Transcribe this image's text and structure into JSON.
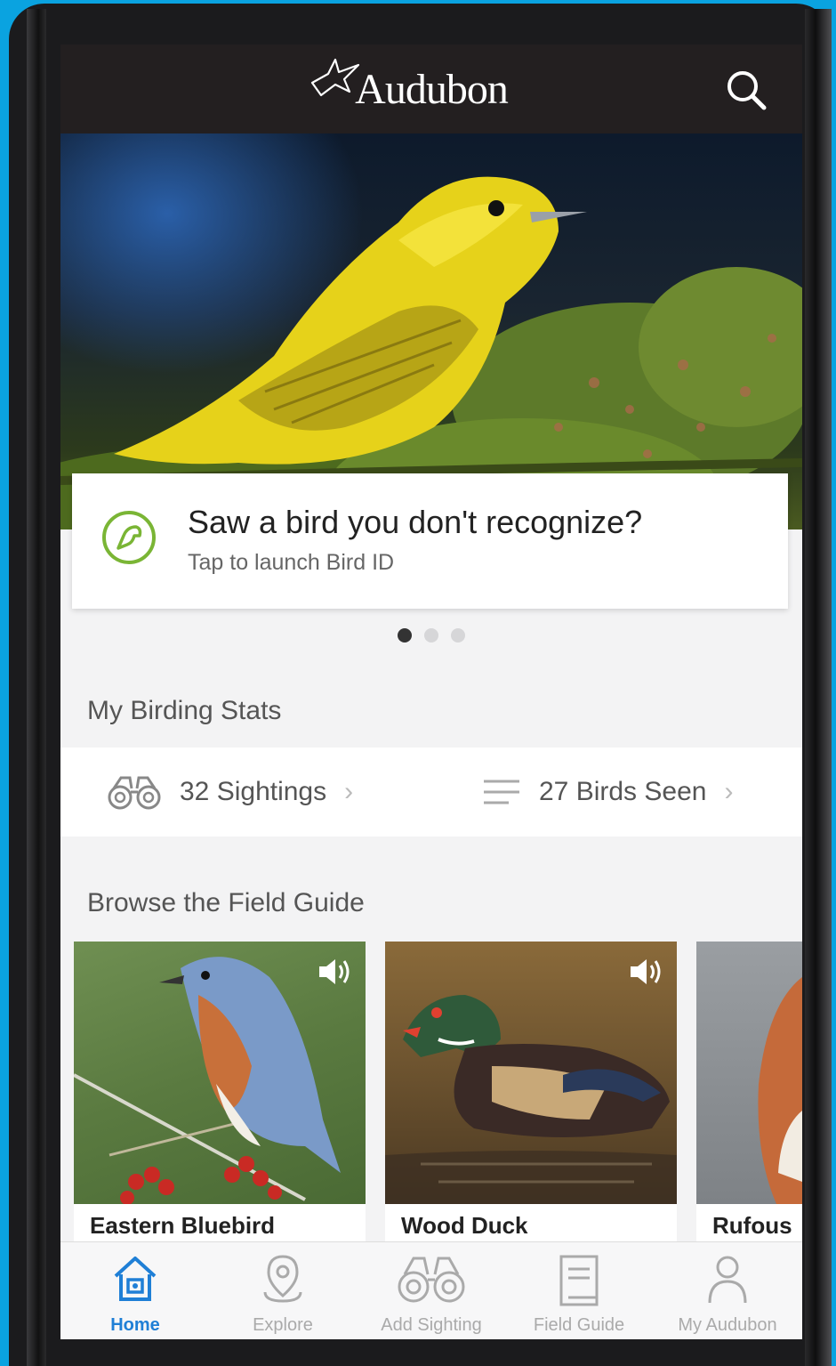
{
  "header": {
    "logo_text": "Audubon",
    "search_icon": "search-icon"
  },
  "hero": {
    "image_alt": "Yellow warbler perched on juniper"
  },
  "bird_id_card": {
    "title": "Saw a bird you don't recognize?",
    "subtitle": "Tap to launch Bird ID",
    "icon": "bird-id-icon",
    "accent_color": "#7ab535"
  },
  "carousel": {
    "page_count": 3,
    "active_index": 0
  },
  "stats": {
    "section_title": "My Birding Stats",
    "sightings_label": "32 Sightings",
    "birds_seen_label": "27 Birds Seen"
  },
  "field_guide": {
    "section_title": "Browse the Field Guide",
    "cards": [
      {
        "name": "Eastern Bluebird",
        "has_audio": true
      },
      {
        "name": "Wood Duck",
        "has_audio": true
      },
      {
        "name": "Rufous",
        "has_audio": false
      }
    ]
  },
  "tabbar": {
    "active_color": "#1f7fd6",
    "inactive_color": "#aaaaaa",
    "tabs": [
      {
        "label": "Home",
        "icon": "home-icon",
        "active": true
      },
      {
        "label": "Explore",
        "icon": "map-pin-icon",
        "active": false
      },
      {
        "label": "Add Sighting",
        "icon": "binoculars-icon",
        "active": false
      },
      {
        "label": "Field Guide",
        "icon": "book-icon",
        "active": false
      },
      {
        "label": "My Audubon",
        "icon": "person-icon",
        "active": false
      }
    ]
  }
}
